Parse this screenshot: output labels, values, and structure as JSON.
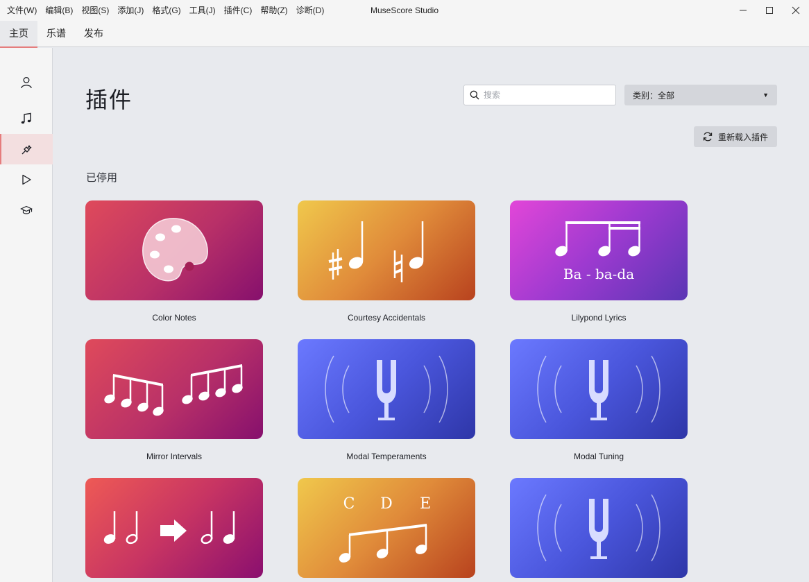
{
  "window": {
    "title": "MuseScore Studio",
    "menu": [
      "文件(W)",
      "编辑(B)",
      "视图(S)",
      "添加(J)",
      "格式(G)",
      "工具(J)",
      "插件(C)",
      "帮助(Z)",
      "诊断(D)"
    ]
  },
  "tabs": [
    "主页",
    "乐谱",
    "发布"
  ],
  "sidebar": {
    "items": [
      {
        "icon": "account-icon"
      },
      {
        "icon": "music-note-icon"
      },
      {
        "icon": "plugin-icon",
        "active": true
      },
      {
        "icon": "play-icon"
      },
      {
        "icon": "learn-icon"
      }
    ]
  },
  "main": {
    "title": "插件",
    "search_placeholder": "搜索",
    "category_label": "类别：",
    "category_value": "全部",
    "reload_label": "重新载入插件",
    "section_title": "已停用"
  },
  "plugins": [
    {
      "name": "Color Notes"
    },
    {
      "name": "Courtesy Accidentals"
    },
    {
      "name": "Lilypond Lyrics",
      "thumb_text": "Ba - ba-da"
    },
    {
      "name": "Mirror Intervals"
    },
    {
      "name": "Modal Temperaments"
    },
    {
      "name": "Modal Tuning"
    },
    {
      "name": ""
    },
    {
      "name": "",
      "thumb_letters": [
        "C",
        "D",
        "E"
      ]
    },
    {
      "name": ""
    }
  ],
  "colors": {
    "accent": "#e57d7d",
    "background": "#e8eaee",
    "sidebar_bg": "#f5f5f5"
  }
}
